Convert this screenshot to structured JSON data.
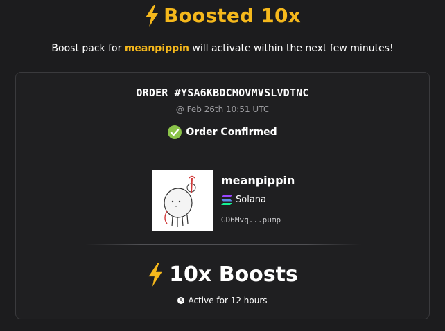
{
  "header": {
    "title": "Boosted 10x",
    "subtitle_prefix": "Boost pack for ",
    "subtitle_token": "meanpippin",
    "subtitle_suffix": " will activate within the next few minutes!",
    "accent_color": "#f5b81c"
  },
  "order": {
    "id_label": "ORDER #YSA6KBDCMOVMVSLVDTNC",
    "time": "@ Feb 26th 10:51 UTC",
    "status": "Order Confirmed",
    "status_color": "#8bc34a"
  },
  "token": {
    "name": "meanpippin",
    "chain": "Solana",
    "address": "GD6Mvq...pump",
    "image_icon": "pippin-mascot-image"
  },
  "boost": {
    "title": "10x Boosts",
    "duration": "Active for 12 hours"
  },
  "icons": {
    "bolt": "lightning-bolt-icon",
    "check": "check-circle-icon",
    "chain": "solana-icon",
    "clock": "clock-icon"
  }
}
